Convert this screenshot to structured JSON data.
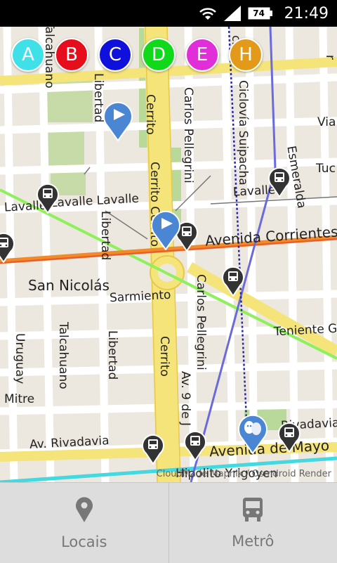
{
  "status_bar": {
    "battery_level": "74",
    "time": "21:49"
  },
  "line_buttons": [
    {
      "label": "A",
      "color": "#3fe0e8"
    },
    {
      "label": "B",
      "color": "#e60d1c"
    },
    {
      "label": "C",
      "color": "#1010dd"
    },
    {
      "label": "D",
      "color": "#10d81a"
    },
    {
      "label": "E",
      "color": "#e02fd8"
    },
    {
      "label": "H",
      "color": "#e39a1a"
    }
  ],
  "map": {
    "street_labels": {
      "talcahuano_top": "Talcahuano",
      "libertad_top": "Libertad",
      "cerrito_top": "Cerrito",
      "carlos_pellegrini_top": "Carlos Pellegrini",
      "ciclovia_suipacha": "Ciclovía Suipacha",
      "esmeralda": "Esmeralda",
      "lavalle_left": "Lavalle",
      "lavalle_mid": "Lavalle Lavalle",
      "lavalle_right": "Lavalle",
      "libertad_mid": "Libertad",
      "cerrito_mid": "Cerrito Cerrito",
      "avenida_corrientes": "Avenida Corrientes",
      "san_nicolas": "San Nicolás",
      "sarmiento": "Sarmiento",
      "carlos_pellegrini_mid": "Carlos Pellegrini",
      "teniente": "Teniente G",
      "uruguay": "Uruguay",
      "talcahuano_low": "Talcahuano",
      "libertad_low": "Libertad",
      "cerrito_low": "Cerrito",
      "av_9_de_julio": "Av. 9 de J",
      "mitre": "Mitre",
      "av_rivadavia": "Av. Rivadavia",
      "rivadavia_right": "Rivadavia",
      "avenida_de_mayo": "Avenida de Mayo",
      "hipolito": "Hipolito Yrigoyen",
      "via": "Via",
      "tuc": "Tuc",
      "edge_ch": "ch",
      "edge_r": "r"
    },
    "attribution": "CloudMade Mapnik / Osmdroid Render"
  },
  "bottom_nav": {
    "locais_label": "Locais",
    "metro_label": "Metrô"
  }
}
